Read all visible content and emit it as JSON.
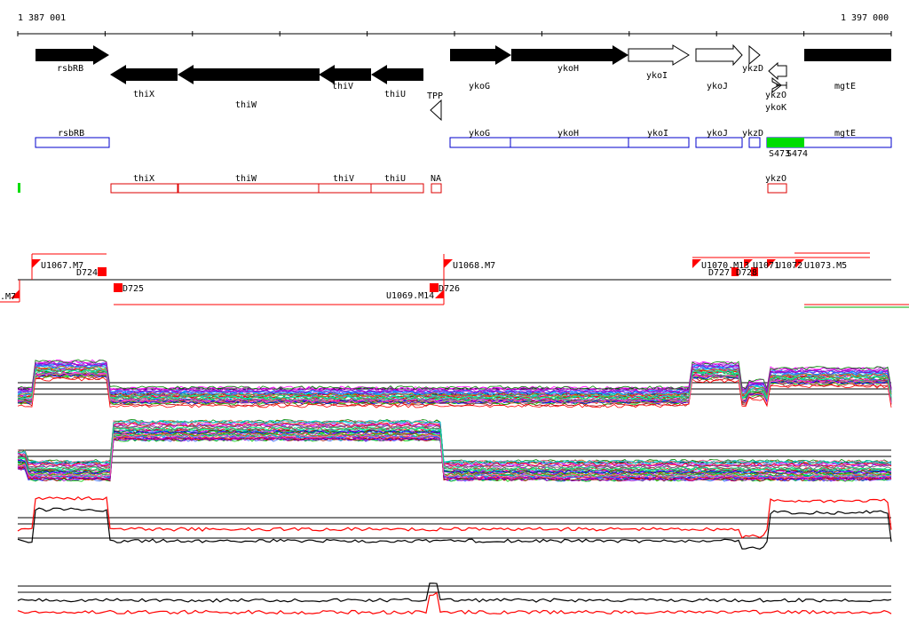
{
  "ruler": {
    "start_label": "1 387 001",
    "end_label": "1 397 000"
  },
  "genes": {
    "rsbRB": "rsbRB",
    "thiX": "thiX",
    "thiW": "thiW",
    "thiV": "thiV",
    "thiU": "thiU",
    "TPP": "TPP",
    "ykoG": "ykoG",
    "ykoH": "ykoH",
    "ykoI": "ykoI",
    "ykoJ": "ykoJ",
    "ykzD": "ykzD",
    "ykzO": "ykzO",
    "ykoK": "ykoK",
    "mgtE": "mgtE"
  },
  "operons_blue": [
    "rsbRB",
    "ykoG",
    "ykoH",
    "ykoI",
    "ykoJ",
    "ykzD",
    "mgtE"
  ],
  "green_labels": {
    "s473": "S473",
    "s474": "S474"
  },
  "operons_red": {
    "thiX": "thiX",
    "thiW": "thiW",
    "thiV": "thiV",
    "thiU": "thiU",
    "NA": "NA",
    "ykzO": "ykzO"
  },
  "segments": {
    "m7_left": ".M7",
    "u1067": "U1067.M7",
    "d724": "D724",
    "d725": "D725",
    "u1069": "U1069.M14",
    "u1068": "U1068.M7",
    "d726": "D726",
    "u1070": "U1070.M13",
    "d727": "D727",
    "d728": "D728",
    "u1071": "U1071",
    "u1072": "U1072",
    "u1073": "U1073.M5",
    "u107x": "U107"
  },
  "colors": {
    "gene_fill": "#000000",
    "blue_box": "#0000cc",
    "red_box": "#dd0000",
    "green": "#00dd00",
    "red_seg": "#ff0000"
  }
}
